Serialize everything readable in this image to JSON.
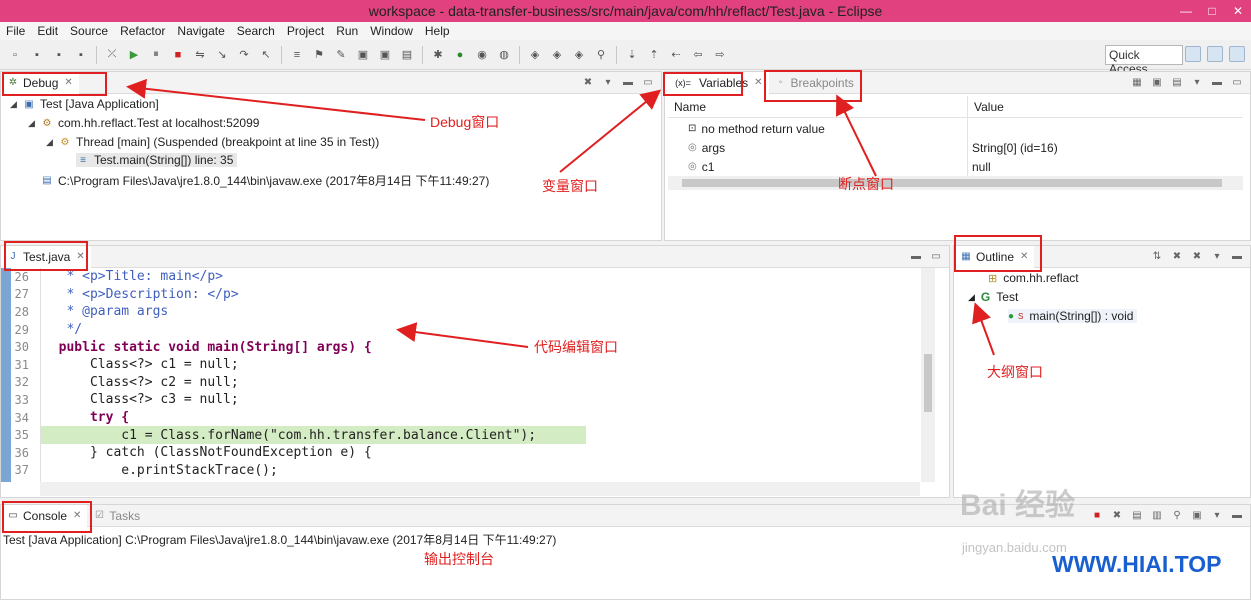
{
  "window": {
    "title": "workspace - data-transfer-business/src/main/java/com/hh/reflact/Test.java - Eclipse",
    "controls": [
      "—",
      "□",
      "✕"
    ]
  },
  "menu": [
    "File",
    "Edit",
    "Source",
    "Refactor",
    "Navigate",
    "Search",
    "Project",
    "Run",
    "Window",
    "Help"
  ],
  "toolbar": {
    "quick_access": "Quick Access"
  },
  "debug_panel": {
    "tab": "Debug",
    "tree": [
      "Test [Java Application]",
      "com.hh.reflact.Test at localhost:52099",
      "Thread [main] (Suspended (breakpoint at line 35 in Test))",
      "Test.main(String[]) line: 35",
      "C:\\Program Files\\Java\\jre1.8.0_144\\bin\\javaw.exe (2017年8月14日 下午11:49:27)"
    ]
  },
  "variables_panel": {
    "tab": "Variables",
    "tab_prefix": "(x)=",
    "breakpoints_tab": "Breakpoints",
    "columns": [
      "Name",
      "Value"
    ],
    "rows": [
      {
        "name": "no method return value",
        "value": ""
      },
      {
        "name": "args",
        "value": "String[0]  (id=16)"
      },
      {
        "name": "c1",
        "value": "null"
      }
    ]
  },
  "editor": {
    "tab": "Test.java",
    "lines": [
      {
        "n": "26",
        "text": "   * <p>Title: main</p>"
      },
      {
        "n": "27",
        "text": "   * <p>Description: </p>"
      },
      {
        "n": "28",
        "text": "   * @param args"
      },
      {
        "n": "29",
        "text": "   */"
      },
      {
        "n": "30",
        "text": "  public static void main(String[] args) {"
      },
      {
        "n": "31",
        "text": "      Class<?> c1 = null;"
      },
      {
        "n": "32",
        "text": "      Class<?> c2 = null;"
      },
      {
        "n": "33",
        "text": "      Class<?> c3 = null;"
      },
      {
        "n": "34",
        "text": "      try {"
      },
      {
        "n": "35",
        "text": "          c1 = Class.forName(\"com.hh.transfer.balance.Client\");"
      },
      {
        "n": "36",
        "text": "      } catch (ClassNotFoundException e) {"
      },
      {
        "n": "37",
        "text": "          e.printStackTrace();"
      }
    ]
  },
  "outline_panel": {
    "tab": "Outline",
    "items": [
      "com.hh.reflact",
      "Test",
      "main(String[]) : void"
    ],
    "static_marker": "S"
  },
  "console_panel": {
    "tab": "Console",
    "tasks_tab": "Tasks",
    "text": "Test [Java Application] C:\\Program Files\\Java\\jre1.8.0_144\\bin\\javaw.exe (2017年8月14日 下午11:49:27)"
  },
  "annotations": {
    "debug": "Debug窗口",
    "variables": "变量窗口",
    "breakpoints": "断点窗口",
    "editor": "代码编辑窗口",
    "outline": "大纲窗口",
    "console": "输出控制台"
  },
  "watermark": {
    "text": "Bai 经验",
    "sub": "jingyan.baidu.com",
    "brand": "WWW.HIAI.TOP"
  },
  "colors": {
    "title_bar": "#e1417e",
    "annotation": "#e02020",
    "highlight": "#d4ecc4",
    "keyword": "#7f0055",
    "brand": "#1a5fcf"
  }
}
